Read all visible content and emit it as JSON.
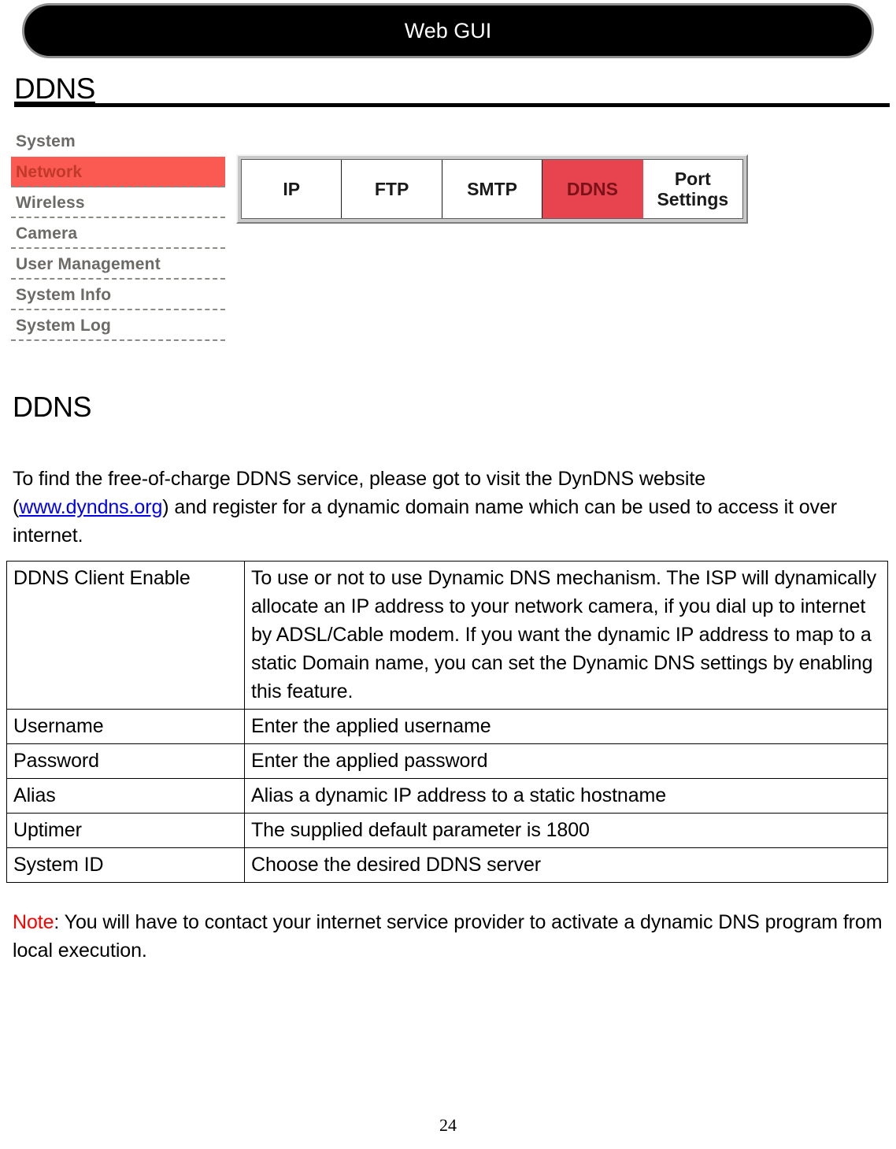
{
  "header": {
    "title": "Web GUI"
  },
  "section": {
    "title": "DDNS"
  },
  "gui_screenshot": {
    "sidebar": {
      "items": [
        {
          "label": "System",
          "active": false
        },
        {
          "label": "Network",
          "active": true
        },
        {
          "label": "Wireless",
          "active": false
        },
        {
          "label": "Camera",
          "active": false
        },
        {
          "label": "User Management",
          "active": false
        },
        {
          "label": "System Info",
          "active": false
        },
        {
          "label": "System Log",
          "active": false
        }
      ]
    },
    "tabs": {
      "items": [
        {
          "label": "IP",
          "active": false
        },
        {
          "label": "FTP",
          "active": false
        },
        {
          "label": "SMTP",
          "active": false
        },
        {
          "label": "DDNS",
          "active": true
        },
        {
          "label": "Port Settings",
          "active": false
        }
      ],
      "active_color": "#e8444f"
    }
  },
  "body": {
    "heading": "DDNS",
    "intro": {
      "before_link": "To find the free-of-charge DDNS service, please got to visit the DynDNS website (",
      "link_text": "www.dyndns.org",
      "after_link": ") and register for a dynamic domain name which can be used to access it over internet."
    }
  },
  "spec_table": {
    "rows": [
      {
        "key": "DDNS Client Enable",
        "value": "To use or not to use Dynamic DNS mechanism. The ISP will dynamically allocate an IP address to your network camera, if you dial up to internet by ADSL/Cable modem. If you want the dynamic IP address to map to a static Domain name, you can set the Dynamic DNS settings by enabling this feature."
      },
      {
        "key": "Username",
        "value": "Enter the applied username"
      },
      {
        "key": "Password",
        "value": "Enter the applied password"
      },
      {
        "key": "Alias",
        "value": "Alias a dynamic IP address to a static hostname"
      },
      {
        "key": "Uptimer",
        "value": "The supplied default parameter is 1800"
      },
      {
        "key": "System ID",
        "value": "Choose the desired DDNS server"
      }
    ]
  },
  "note": {
    "label": "Note",
    "text": ": You will have to contact your internet service provider to activate a dynamic DNS program from local execution."
  },
  "footer": {
    "page_number": "24"
  },
  "colors": {
    "accent_red": "#e8444f",
    "sidebar_highlight": "#fa5a52",
    "link_blue": "#0000ee",
    "note_red": "#ff0000"
  }
}
